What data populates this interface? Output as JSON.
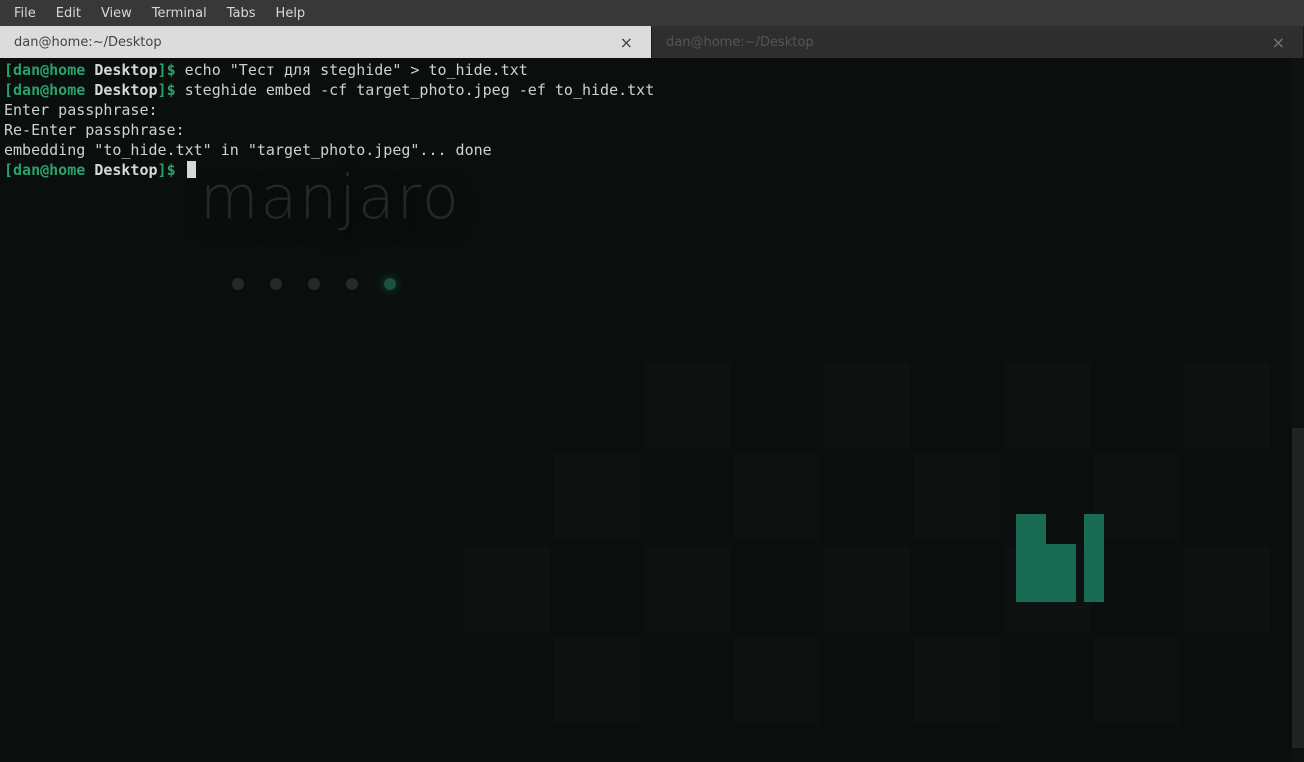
{
  "menubar": {
    "items": [
      "File",
      "Edit",
      "View",
      "Terminal",
      "Tabs",
      "Help"
    ]
  },
  "tabs": [
    {
      "title": "dan@home:~/Desktop",
      "active": true
    },
    {
      "title": "dan@home:~/Desktop",
      "active": false
    }
  ],
  "prompt": {
    "user": "dan",
    "host": "home",
    "dir": "Desktop",
    "open": "[",
    "at": "@",
    "close": "]",
    "sep": " ",
    "dollar": "$"
  },
  "lines": [
    {
      "type": "cmd",
      "text": " echo \"Тест для steghide\" > to_hide.txt"
    },
    {
      "type": "cmd",
      "text": " steghide embed -cf target_photo.jpeg -ef to_hide.txt"
    },
    {
      "type": "out",
      "text": "Enter passphrase:"
    },
    {
      "type": "out",
      "text": "Re-Enter passphrase:"
    },
    {
      "type": "out",
      "text": "embedding \"to_hide.txt\" in \"target_photo.jpeg\"... done"
    },
    {
      "type": "cmd",
      "text": " ",
      "cursor": true
    }
  ],
  "watermark": "manjaro",
  "close_glyph": "×"
}
